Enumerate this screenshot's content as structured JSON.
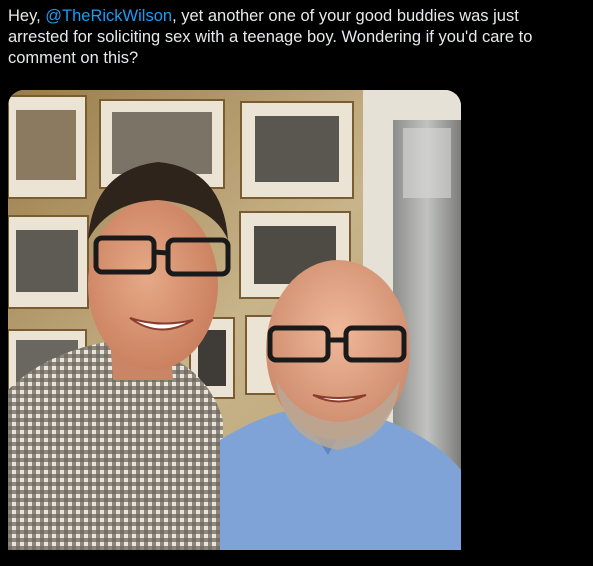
{
  "tweet": {
    "text_prefix": "Hey, ",
    "mention": "@TheRickWilson",
    "text_suffix": ", yet another one of your good buddies was just arrested for soliciting sex with a teenage boy. Wondering if you'd care to comment on this?"
  },
  "media": {
    "type": "photo",
    "subject": "selfie of two smiling men wearing glasses in front of a wall of framed photographs",
    "colors": {
      "wall": "#c8b48a",
      "frame": "#e9e2d2",
      "fridge": "#a9aaa8",
      "shirt_left": "#5b554d",
      "shirt_right": "#7fa3d6",
      "skin": "#d99a78"
    }
  },
  "colors": {
    "background": "#000000",
    "text": "#e7e9ea",
    "mention": "#1d9bf0"
  }
}
